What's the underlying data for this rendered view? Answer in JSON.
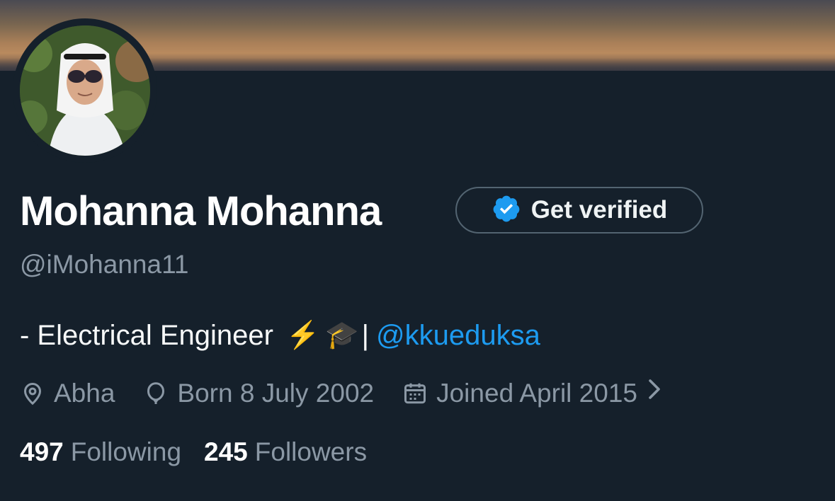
{
  "profile": {
    "display_name": "Mohanna Mohanna",
    "handle": "@iMohanna11",
    "get_verified_label": "Get verified",
    "bio": {
      "prefix": "- Electrical Engineer",
      "emoji_1": "⚡",
      "emoji_2": "🎓",
      "separator": "|",
      "mention": "@kkueduksa"
    },
    "location": "Abha",
    "birthday": "Born 8 July 2002",
    "joined": "Joined April 2015",
    "following_count": "497",
    "following_label": "Following",
    "followers_count": "245",
    "followers_label": "Followers"
  },
  "icons": {
    "location": "location-pin-icon",
    "birthday": "balloon-icon",
    "joined": "calendar-icon",
    "chevron": "chevron-right-icon",
    "verified": "verified-badge-icon"
  },
  "colors": {
    "background": "#15202b",
    "accent": "#1d9bf0",
    "secondary_text": "#8b98a5"
  }
}
